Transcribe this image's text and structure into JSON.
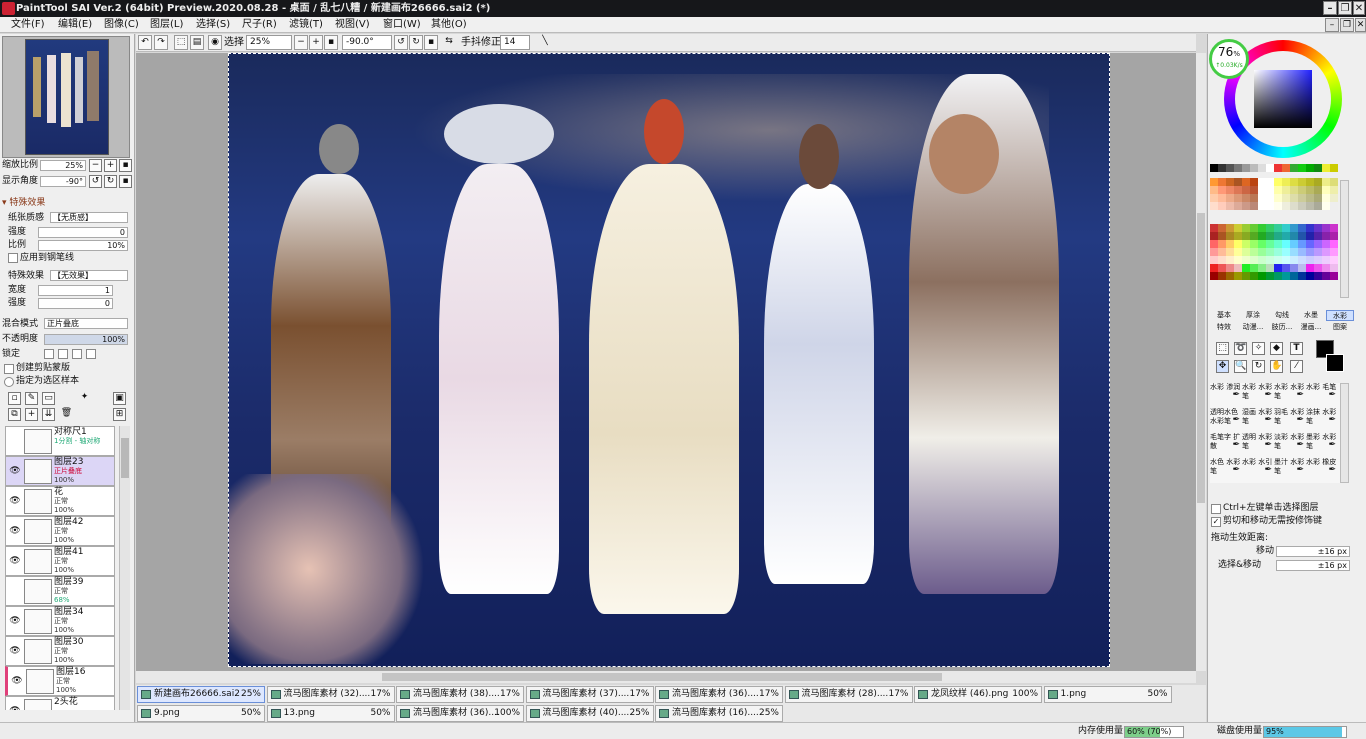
{
  "window": {
    "title": "PaintTool SAI Ver.2 (64bit) Preview.2020.08.28 - 桌面 / 乱七八糟 / 新建画布26666.sai2 (*)"
  },
  "menu": [
    "文件(F)",
    "编辑(E)",
    "图像(C)",
    "图层(L)",
    "选择(S)",
    "尺子(R)",
    "滤镜(T)",
    "视图(V)",
    "窗口(W)",
    "其他(O)"
  ],
  "toolbar": {
    "select_label": "选择",
    "zoom": "25%",
    "angle": "-90.0°",
    "stabilizer_label": "手抖修正",
    "stabilizer_value": "14"
  },
  "navigator": {
    "zoom_label": "缩放比例",
    "zoom_value": "25%",
    "angle_label": "显示角度",
    "angle_value": "-90°"
  },
  "effects": {
    "header": "特殊效果",
    "paper_label": "纸张质感",
    "paper_value": "【无质感】",
    "strength_label": "强度",
    "strength_value": "0",
    "scale_label": "比例",
    "scale_value": "10%",
    "apply_pen_label": "应用到钢笔线",
    "effect_label": "特殊效果",
    "effect_value": "【无效果】",
    "width_label": "宽度",
    "width_value": "1",
    "strength2_label": "强度",
    "strength2_value": "0"
  },
  "layer_props": {
    "blend_label": "混合模式",
    "blend_value": "正片叠底",
    "opacity_label": "不透明度",
    "opacity_value": "100%",
    "lock_label": "锁定",
    "clip_label": "创建剪贴蒙版",
    "selsrc_label": "指定为选区样本"
  },
  "layers": [
    {
      "name": "对称尺1",
      "mode": "1分割 - 轴对称",
      "opacity": "",
      "visible": false,
      "selected": false
    },
    {
      "name": "图层23",
      "mode": "正片叠底",
      "opacity": "100%",
      "visible": true,
      "selected": true
    },
    {
      "name": "花",
      "mode": "正常",
      "opacity": "100%",
      "visible": true,
      "selected": false
    },
    {
      "name": "图层42",
      "mode": "正常",
      "opacity": "100%",
      "visible": true,
      "selected": false
    },
    {
      "name": "图层41",
      "mode": "正常",
      "opacity": "100%",
      "visible": true,
      "selected": false
    },
    {
      "name": "图层39",
      "mode": "正常",
      "opacity": "68%",
      "visible": false,
      "selected": false
    },
    {
      "name": "图层34",
      "mode": "正常",
      "opacity": "100%",
      "visible": true,
      "selected": false
    },
    {
      "name": "图层30",
      "mode": "正常",
      "opacity": "100%",
      "visible": true,
      "selected": false
    },
    {
      "name": "图层16",
      "mode": "正常",
      "opacity": "100%",
      "visible": true,
      "selected": false
    },
    {
      "name": "2头花",
      "mode": "",
      "opacity": "",
      "visible": true,
      "selected": false
    }
  ],
  "docs": [
    {
      "name": "新建画布26666.sai2",
      "zoom": "25%",
      "active": true
    },
    {
      "name": "流马图库素材 (32)....",
      "zoom": "17%"
    },
    {
      "name": "流马图库素材 (38)....",
      "zoom": "17%"
    },
    {
      "name": "流马图库素材 (37)....",
      "zoom": "17%"
    },
    {
      "name": "流马图库素材 (36)....",
      "zoom": "17%"
    },
    {
      "name": "流马图库素材 (28)....",
      "zoom": "17%"
    },
    {
      "name": "龙凤纹样 (46).png",
      "zoom": "100%"
    },
    {
      "name": "1.png",
      "zoom": "50%"
    },
    {
      "name": "9.png",
      "zoom": "50%"
    },
    {
      "name": "13.png",
      "zoom": "50%"
    },
    {
      "name": "流马图库素材 (36)....",
      "zoom": "100%"
    },
    {
      "name": "流马图库素材 (40)....",
      "zoom": "25%"
    },
    {
      "name": "流马图库素材 (16)....",
      "zoom": "25%"
    }
  ],
  "color": {
    "gauge_value": "76",
    "gauge_unit": "%",
    "gauge_sub": "↑0.03K/s"
  },
  "tool_tabs": {
    "row1": [
      "基本",
      "厚涂",
      "勾线",
      "水墨",
      "水彩"
    ],
    "row2": [
      "特效",
      "动漫...",
      "肢历...",
      "漫画...",
      "图案"
    ]
  },
  "brushes": [
    [
      "水彩 渗润",
      "水彩 水彩笔",
      "水彩 水彩笔",
      "水彩 毛笔"
    ],
    [
      "透明水色 水彩笔",
      "湿画 水彩笔",
      "羽毛 水彩笔",
      "涂抹 水彩笔"
    ],
    [
      "毛笔字 扩散",
      "透明 水彩笔",
      "淡彩 水彩笔",
      "墨彩 水彩笔"
    ],
    [
      "水色 水彩笔",
      "水彩 水引",
      "墨汁 水彩笔",
      "水彩 橡皮"
    ]
  ],
  "options": {
    "ctrl_click": "Ctrl+左键单击选择图层",
    "cut_move": "剪切和移动无需按修饰键",
    "drag_label": "拖动生效距离:",
    "move_label": "移动",
    "move_value": "±16 px",
    "selmove_label": "选择&移动",
    "selmove_value": "±16 px"
  },
  "status": {
    "mem_label": "内存使用量",
    "mem_value": "60% (70%)",
    "disk_label": "磁盘使用量",
    "disk_value": "95%"
  }
}
